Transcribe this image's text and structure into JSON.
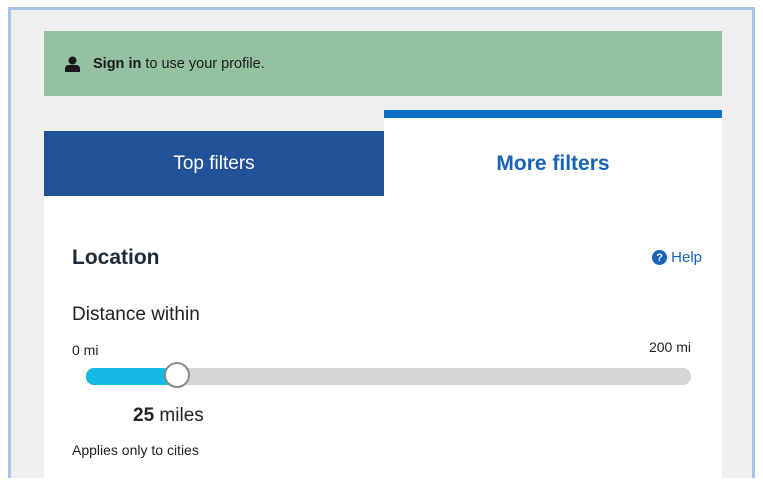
{
  "signin_bar": {
    "icon": "user-icon",
    "link_text": "Sign in",
    "message": " to use your profile."
  },
  "tabs": [
    {
      "label": "Top filters",
      "active": false
    },
    {
      "label": "More filters",
      "active": true
    }
  ],
  "location": {
    "title": "Location",
    "help_icon": "question-circle-icon",
    "help_label": "Help",
    "distance_label": "Distance within",
    "slider": {
      "min_label": "0 mi",
      "max_label": "200 mi",
      "min": 0,
      "max": 200,
      "value": 25,
      "value_num": "25",
      "value_unit": " miles"
    },
    "note": "Applies only to cities"
  },
  "colors": {
    "signin_bg": "#94c1a2",
    "tab_inactive_bg": "#215197",
    "tab_active_accent": "#0f6fc6",
    "link_blue": "#1564b8",
    "slider_fill": "#14b9e6",
    "frame_border": "#a7c4e8"
  }
}
